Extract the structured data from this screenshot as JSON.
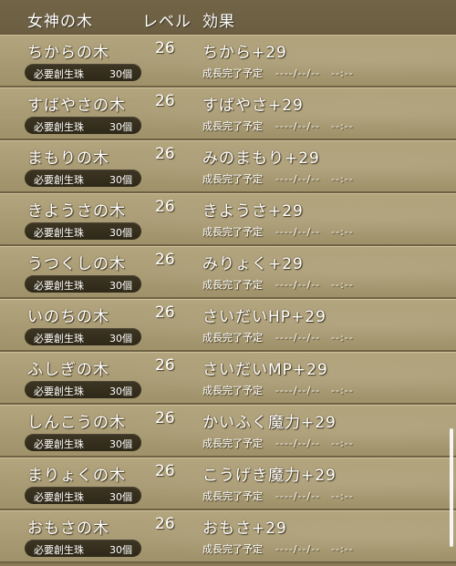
{
  "header": {
    "name_col": "女神の木",
    "level_col": "レベル",
    "effect_col": "効果"
  },
  "trees": [
    {
      "name": "ちからの木",
      "level": "26",
      "effect": "ちから+29",
      "cost_label": "必要創生珠",
      "cost": "30個",
      "status": "成長完了予定",
      "eta": "----/--/--　--:--"
    },
    {
      "name": "すばやさの木",
      "level": "26",
      "effect": "すばやさ+29",
      "cost_label": "必要創生珠",
      "cost": "30個",
      "status": "成長完了予定",
      "eta": "----/--/--　--:--"
    },
    {
      "name": "まもりの木",
      "level": "26",
      "effect": "みのまもり+29",
      "cost_label": "必要創生珠",
      "cost": "30個",
      "status": "成長完了予定",
      "eta": "----/--/--　--:--"
    },
    {
      "name": "きようさの木",
      "level": "26",
      "effect": "きようさ+29",
      "cost_label": "必要創生珠",
      "cost": "30個",
      "status": "成長完了予定",
      "eta": "----/--/--　--:--"
    },
    {
      "name": "うつくしの木",
      "level": "26",
      "effect": "みりょく+29",
      "cost_label": "必要創生珠",
      "cost": "30個",
      "status": "成長完了予定",
      "eta": "----/--/--　--:--"
    },
    {
      "name": "いのちの木",
      "level": "26",
      "effect": "さいだいHP+29",
      "cost_label": "必要創生珠",
      "cost": "30個",
      "status": "成長完了予定",
      "eta": "----/--/--　--:--"
    },
    {
      "name": "ふしぎの木",
      "level": "26",
      "effect": "さいだいMP+29",
      "cost_label": "必要創生珠",
      "cost": "30個",
      "status": "成長完了予定",
      "eta": "----/--/--　--:--"
    },
    {
      "name": "しんこうの木",
      "level": "26",
      "effect": "かいふく魔力+29",
      "cost_label": "必要創生珠",
      "cost": "30個",
      "status": "成長完了予定",
      "eta": "----/--/--　--:--"
    },
    {
      "name": "まりょくの木",
      "level": "26",
      "effect": "こうげき魔力+29",
      "cost_label": "必要創生珠",
      "cost": "30個",
      "status": "成長完了予定",
      "eta": "----/--/--　--:--"
    },
    {
      "name": "おもさの木",
      "level": "26",
      "effect": "おもさ+29",
      "cost_label": "必要創生珠",
      "cost": "30個",
      "status": "成長完了予定",
      "eta": "----/--/--　--:--"
    }
  ]
}
